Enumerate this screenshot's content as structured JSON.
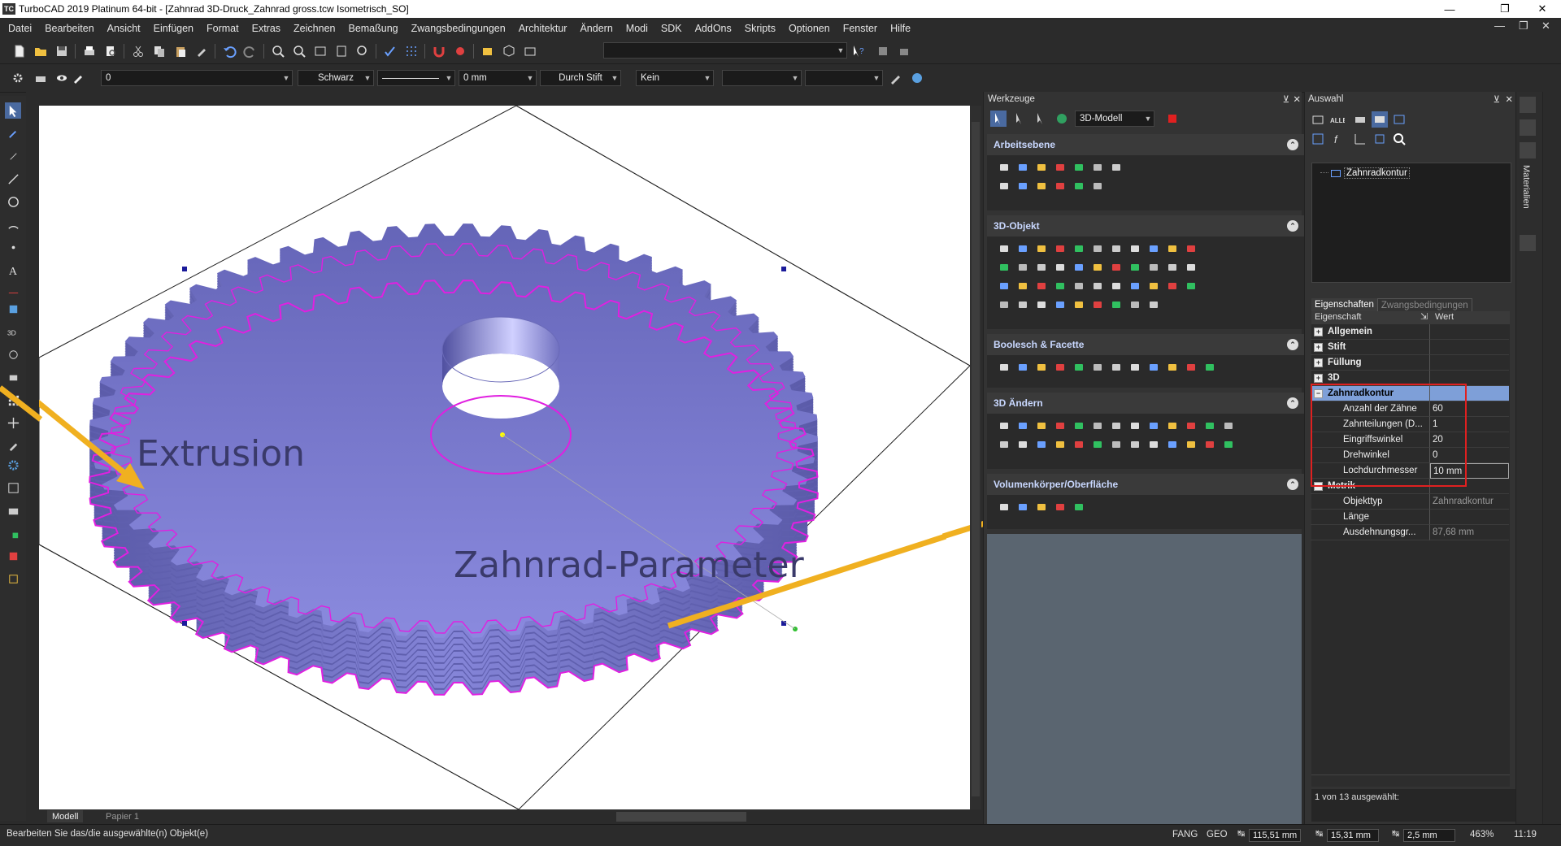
{
  "window": {
    "title": "TurboCAD 2019 Platinum 64-bit - [Zahnrad 3D-Druck_Zahnrad gross.tcw Isometrisch_SO]",
    "app_icon": "TC"
  },
  "menu": [
    "Datei",
    "Bearbeiten",
    "Ansicht",
    "Einfügen",
    "Format",
    "Extras",
    "Zeichnen",
    "Bemaßung",
    "Zwangsbedingungen",
    "Architektur",
    "Ändern",
    "Modi",
    "SDK",
    "AddOns",
    "Skripts",
    "Optionen",
    "Fenster",
    "Hilfe"
  ],
  "property_bar": {
    "layer_value": "0",
    "color": "Schwarz",
    "width": "0 mm",
    "pen_mode": "Durch Stift",
    "fill": "Kein"
  },
  "canvas": {
    "annotation_extrusion": "Extrusion",
    "annotation_parameter": "Zahnrad-Parameter",
    "gear_fill_color": "#7b7bcf",
    "contour_color": "#e020e0",
    "arrow_color": "#f0b020"
  },
  "tabs": [
    "Modell",
    "Papier 1"
  ],
  "status": {
    "message": "Bearbeiten Sie das/die ausgewählte(n) Objekt(e)",
    "snap": "FANG",
    "geo": "GEO",
    "coord_x": "115,51 mm",
    "coord_y": "15,31 mm",
    "coord_z": "2,5 mm",
    "zoom": "463%",
    "time": "11:19"
  },
  "werkzeuge": {
    "title": "Werkzeuge",
    "mode_combo": "3D-Modell",
    "sections": [
      "Arbeitsebene",
      "3D-Objekt",
      "Boolesch & Facette",
      "3D Ändern",
      "Volumenkörper/Oberfläche"
    ]
  },
  "auswahl": {
    "title": "Auswahl",
    "tree_item": "Zahnradkontur",
    "tab_properties": "Eigenschaften",
    "tab_constraints": "Zwangsbedingungen",
    "col_property": "Eigenschaft",
    "col_value": "Wert",
    "groups": {
      "allgemein": "Allgemein",
      "stift": "Stift",
      "fuellung": "Füllung",
      "drei_d": "3D",
      "zahnradkontur": "Zahnradkontur",
      "metrik": "Metrik"
    },
    "params": [
      {
        "k": "Anzahl der Zähne",
        "v": "60"
      },
      {
        "k": "Zahnteilungen (D...",
        "v": "1"
      },
      {
        "k": "Eingriffswinkel",
        "v": "20"
      },
      {
        "k": "Drehwinkel",
        "v": "0"
      },
      {
        "k": "Lochdurchmesser",
        "v": "10 mm"
      }
    ],
    "metrics": [
      {
        "k": "Objekttyp",
        "v": "Zahnradkontur"
      },
      {
        "k": "Länge",
        "v": ""
      },
      {
        "k": "Ausdehnungsgr...",
        "v": "87,68 mm"
      }
    ],
    "selection_status": "1 von 13 ausgewählt:"
  },
  "right_dock": {
    "materials_label": "Materialien"
  }
}
